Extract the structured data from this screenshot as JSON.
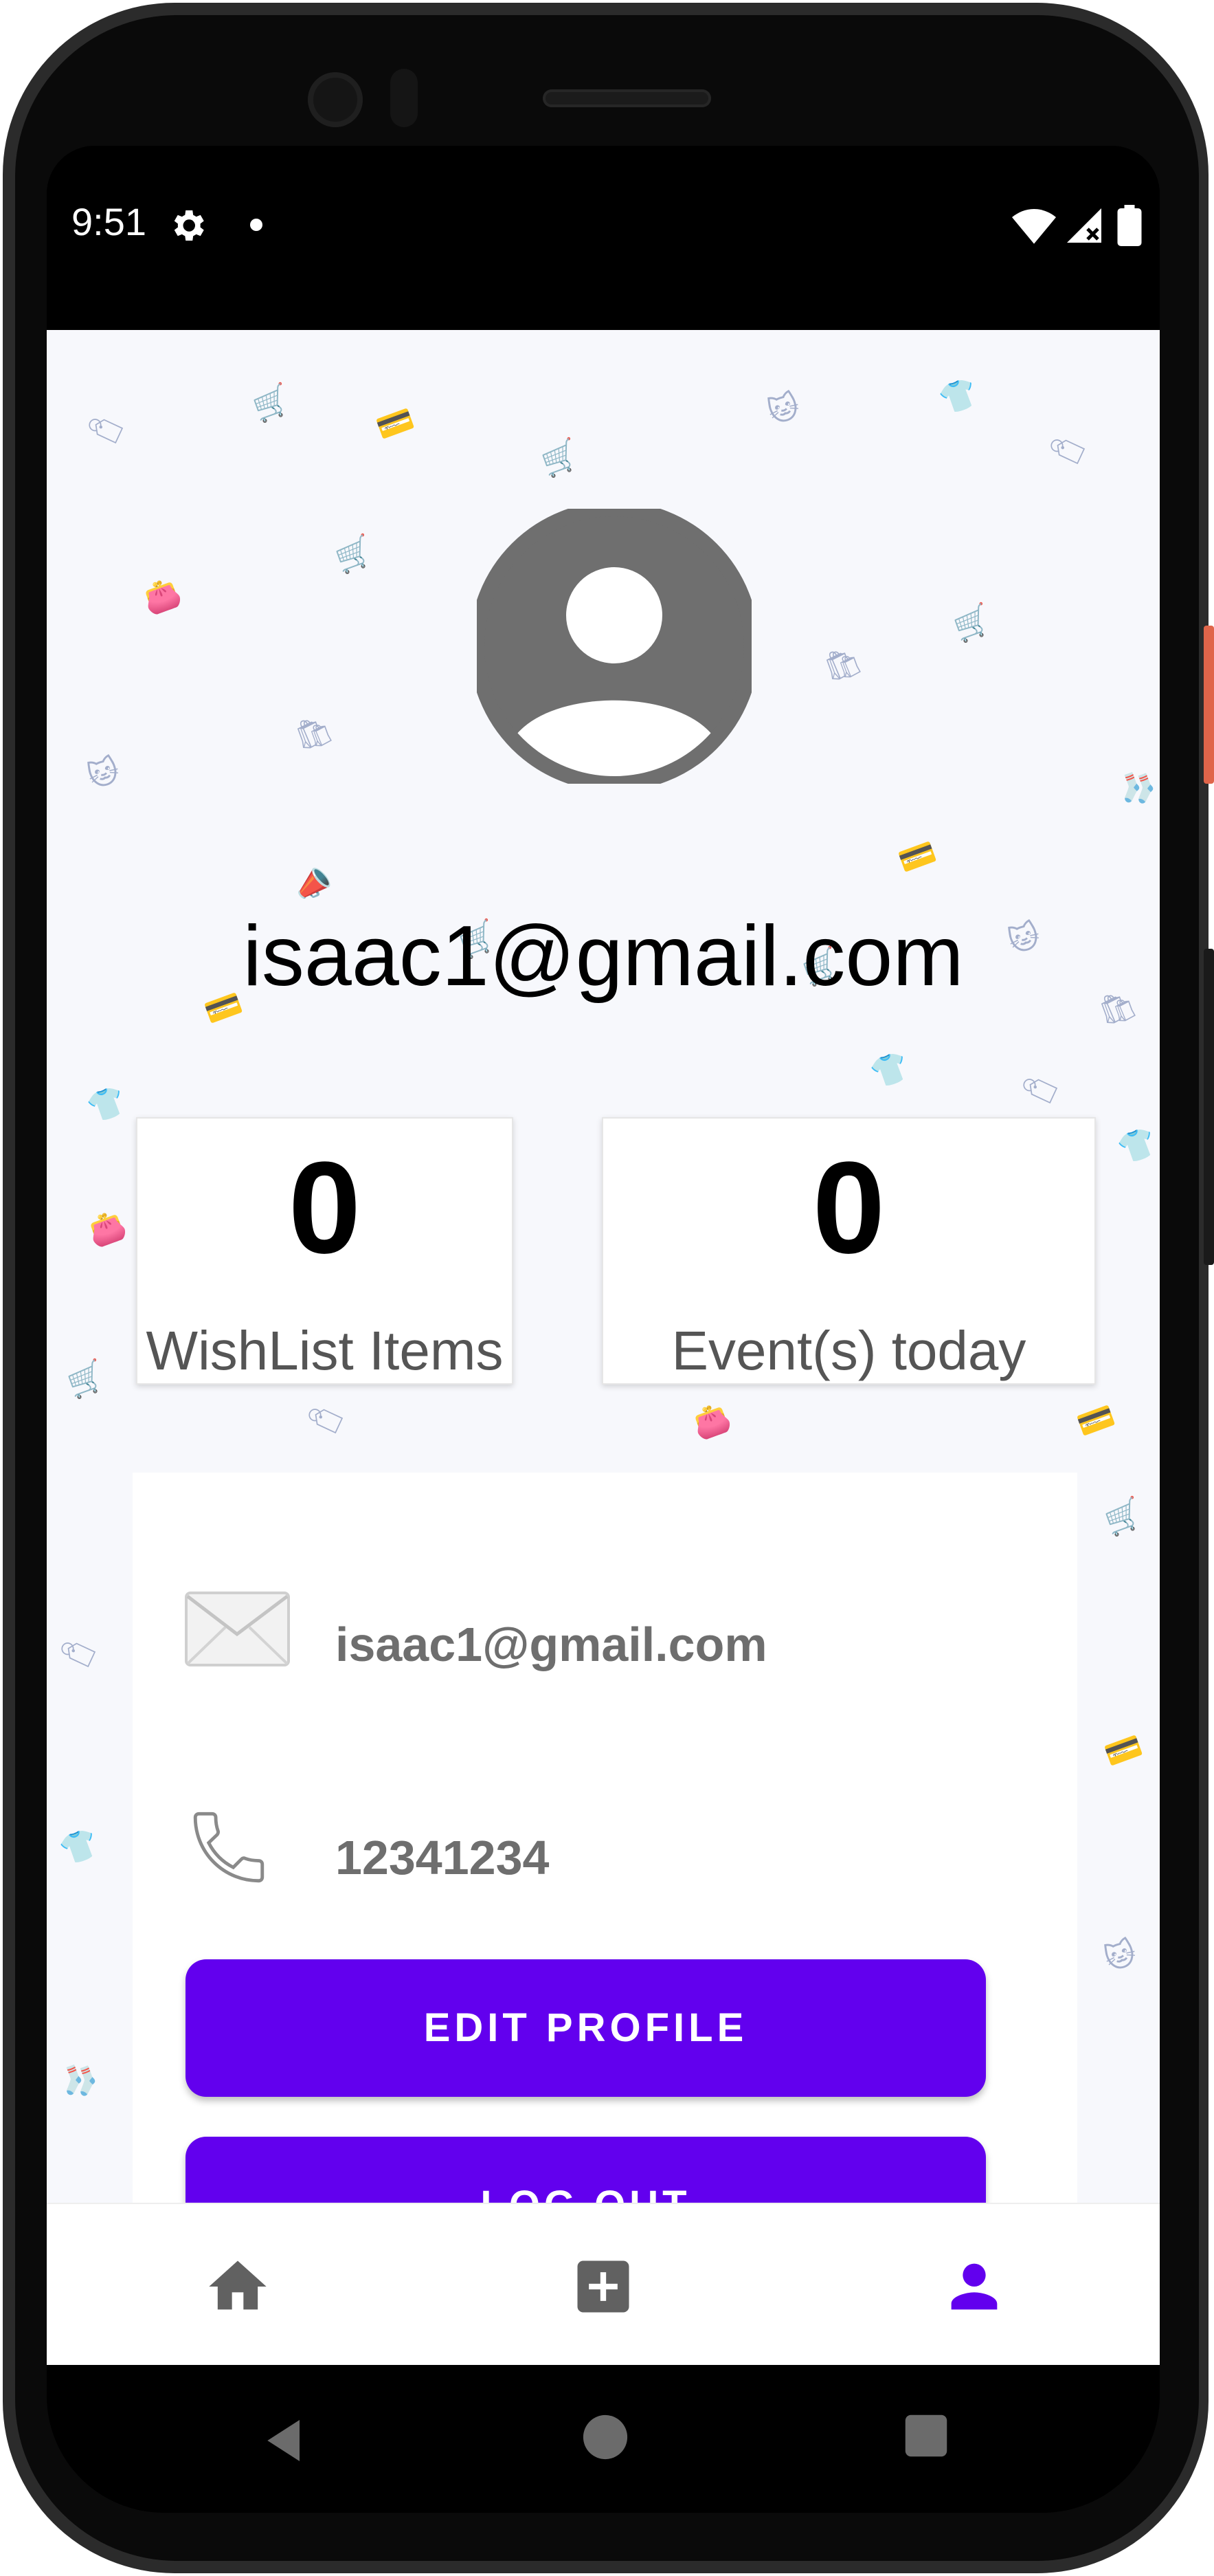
{
  "status_bar": {
    "time": "9:51",
    "icons": [
      "settings-gear-icon",
      "notification-dot-icon",
      "wifi-icon",
      "signal-icon",
      "battery-icon"
    ]
  },
  "profile": {
    "avatar": "account-circle-icon",
    "email": "isaac1@gmail.com"
  },
  "stats": {
    "wishlist_count": "0",
    "wishlist_label": "WishList Items",
    "events_count": "0",
    "events_label": "Event(s) today"
  },
  "info": {
    "email_icon": "envelope-icon",
    "email": "isaac1@gmail.com",
    "phone_icon": "phone-icon",
    "phone": "12341234"
  },
  "buttons": {
    "edit_profile": "EDIT PROFILE",
    "log_out": "LOG OUT"
  },
  "bottom_nav": {
    "items": [
      {
        "icon": "home-icon",
        "active": false
      },
      {
        "icon": "add-box-icon",
        "active": false
      },
      {
        "icon": "person-icon",
        "active": true
      }
    ],
    "active_color": "#6200ee",
    "inactive_color": "#616161"
  },
  "colors": {
    "accent": "#6200ee"
  }
}
